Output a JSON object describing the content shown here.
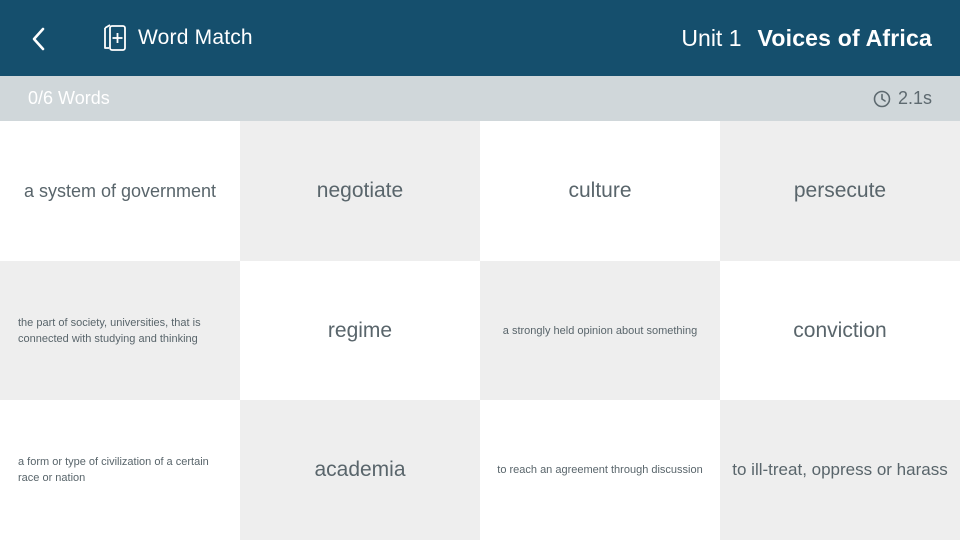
{
  "header": {
    "app_title": "Word Match",
    "unit_number": "Unit 1",
    "unit_name": "Voices of Africa",
    "icons": {
      "back": "chevron-left-icon",
      "app": "flashcard-add-icon"
    },
    "colors": {
      "bar": "#154f6d",
      "status_bar": "#d0d7da"
    }
  },
  "status": {
    "progress": "0/6 Words",
    "timer": "2.1s",
    "timer_icon": "clock-icon"
  },
  "tiles": [
    {
      "text": "a system of government",
      "kind": "definition"
    },
    {
      "text": "negotiate",
      "kind": "word"
    },
    {
      "text": "culture",
      "kind": "word"
    },
    {
      "text": "persecute",
      "kind": "word"
    },
    {
      "text": "the part of society, universities, that is connected with studying and thinking",
      "kind": "definition"
    },
    {
      "text": "regime",
      "kind": "word"
    },
    {
      "text": "a strongly held opinion about something",
      "kind": "definition"
    },
    {
      "text": "conviction",
      "kind": "word"
    },
    {
      "text": "a form or type of civilization of a certain race or nation",
      "kind": "definition"
    },
    {
      "text": "academia",
      "kind": "word"
    },
    {
      "text": "to reach an agreement through discussion",
      "kind": "definition"
    },
    {
      "text": "to ill-treat, oppress or harass",
      "kind": "definition"
    }
  ]
}
